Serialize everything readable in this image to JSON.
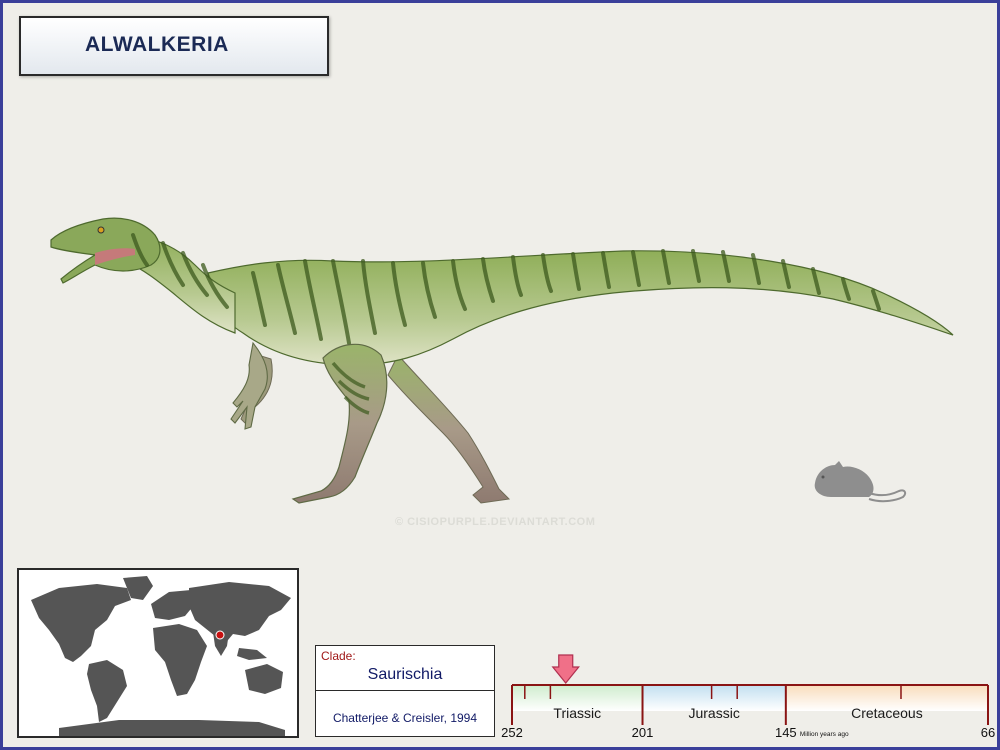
{
  "title": "ALWALKERIA",
  "watermark": "© CISIOPURPLE.DEVIANTART.COM",
  "images": {
    "dinosaur": "green striped theropod dinosaur illustration",
    "mouse": "grey mouse silhouette for scale",
    "world_map": "grey world map with location marker in India"
  },
  "map": {
    "marker_color": "#c81010",
    "land_color": "#555555"
  },
  "clade": {
    "label": "Clade:",
    "value": "Saurischia",
    "authority": "Chatterjee & Creisler, 1994"
  },
  "timeline": {
    "periods": [
      {
        "name": "Triassic",
        "start": 252,
        "end": 201,
        "color": "#cfeccd"
      },
      {
        "name": "Jurassic",
        "start": 201,
        "end": 145,
        "color": "#c2dff0"
      },
      {
        "name": "Cretaceous",
        "start": 145,
        "end": 66,
        "color": "#f8dcbc"
      }
    ],
    "tick_labels": [
      "252",
      "201",
      "145",
      "66"
    ],
    "unit": "Million years ago",
    "marker_ma": 231,
    "marker_color": "#f07088"
  }
}
